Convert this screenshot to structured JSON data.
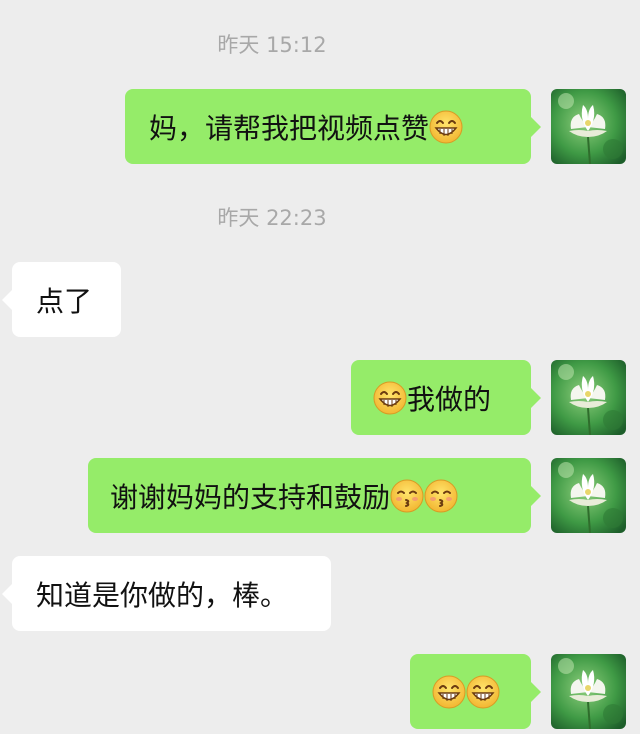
{
  "timestamps": [
    "昨天  15:12",
    "昨天  22:23"
  ],
  "messages": [
    {
      "dir": "out",
      "text": "妈，请帮我把视频点赞",
      "emoji": [
        "grin"
      ]
    },
    {
      "dir": "in",
      "text": "点了"
    },
    {
      "dir": "out",
      "text": "我做的",
      "emoji_before": [
        "grin"
      ]
    },
    {
      "dir": "out",
      "text": "谢谢妈妈的支持和鼓励",
      "emoji": [
        "kiss",
        "kiss"
      ]
    },
    {
      "dir": "in",
      "text": "知道是你做的，棒。"
    },
    {
      "dir": "out",
      "text": "",
      "emoji": [
        "grin",
        "grin"
      ]
    }
  ],
  "avatar": {
    "name": "white-lotus-avatar"
  },
  "colors": {
    "background": "#ededed",
    "outgoing": "#95ec69",
    "incoming": "#ffffff",
    "timestamp": "#a8a8a8"
  }
}
